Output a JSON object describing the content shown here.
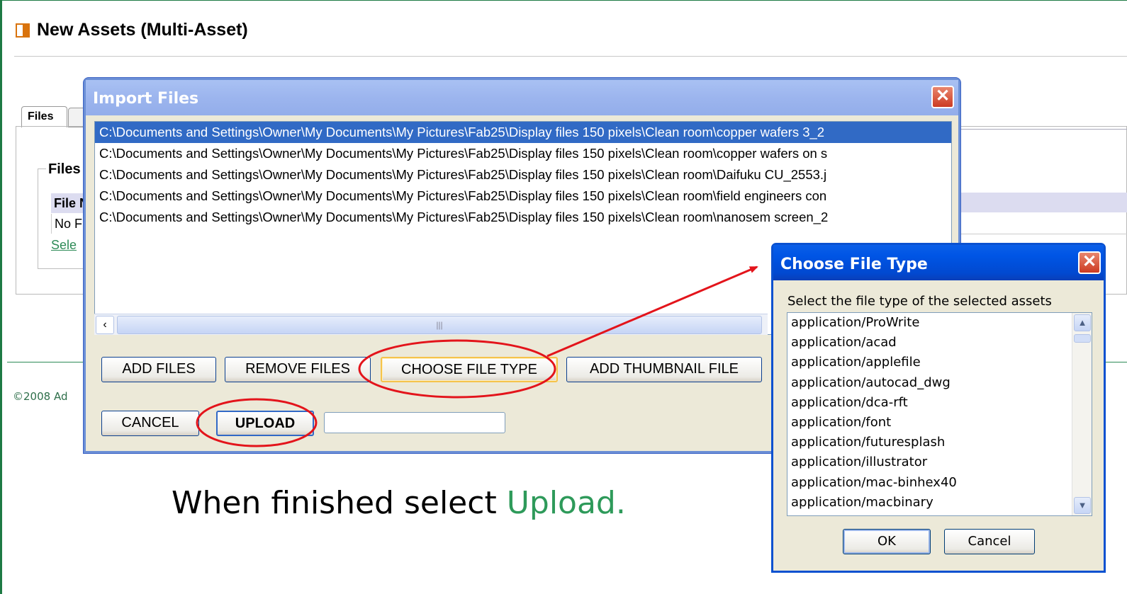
{
  "page": {
    "title": "New Assets (Multi-Asset)"
  },
  "background": {
    "tab_files": "Files",
    "fieldset_legend": "Files",
    "table_header": "File N",
    "no_files": "No F",
    "select_link": "Sele",
    "copyright": "©2008 Ad"
  },
  "import_dialog": {
    "title": "Import Files",
    "close": "✕",
    "files": [
      "C:\\Documents and Settings\\Owner\\My Documents\\My Pictures\\Fab25\\Display files 150 pixels\\Clean room\\copper wafers 3_2",
      "C:\\Documents and Settings\\Owner\\My Documents\\My Pictures\\Fab25\\Display files 150 pixels\\Clean room\\copper wafers on s",
      "C:\\Documents and Settings\\Owner\\My Documents\\My Pictures\\Fab25\\Display files 150 pixels\\Clean room\\Daifuku CU_2553.j",
      "C:\\Documents and Settings\\Owner\\My Documents\\My Pictures\\Fab25\\Display files 150 pixels\\Clean room\\field engineers con",
      "C:\\Documents and Settings\\Owner\\My Documents\\My Pictures\\Fab25\\Display files 150 pixels\\Clean room\\nanosem screen_2"
    ],
    "buttons": {
      "add_files": "ADD FILES",
      "remove_files": "REMOVE FILES",
      "choose_file_type": "CHOOSE FILE TYPE",
      "add_thumbnail": "ADD THUMBNAIL FILE",
      "cancel": "CANCEL",
      "upload": "UPLOAD"
    },
    "upload_field_value": ""
  },
  "type_dialog": {
    "title": "Choose File Type",
    "close": "✕",
    "prompt": "Select the file type of the selected assets",
    "types": [
      "application/ProWrite",
      "application/acad",
      "application/applefile",
      "application/autocad_dwg",
      "application/dca-rft",
      "application/font",
      "application/futuresplash",
      "application/illustrator",
      "application/mac-binhex40",
      "application/macbinary"
    ],
    "ok": "OK",
    "cancel": "Cancel"
  },
  "caption": {
    "text": "When finished select ",
    "highlight": "Upload."
  },
  "colors": {
    "annotation_red": "#e3141b",
    "caption_green": "#2e9a5a",
    "selection_blue": "#316ac5"
  }
}
